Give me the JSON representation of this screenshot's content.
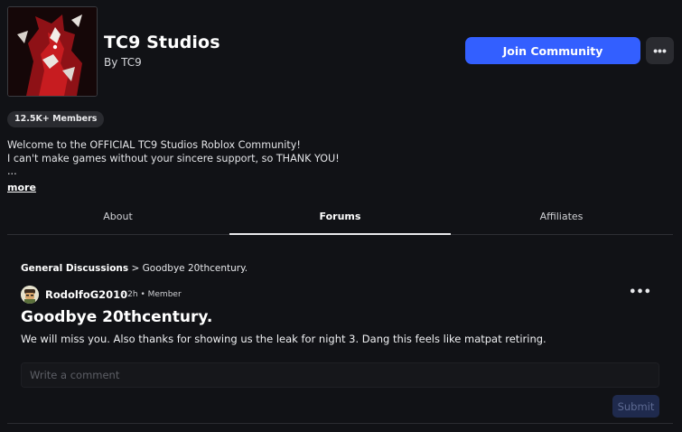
{
  "group": {
    "name": "TC9 Studios",
    "owner_line": "By TC9",
    "members_badge": "12.5K+ Members",
    "join_label": "Join Community",
    "more_menu_icon": "ellipsis-icon"
  },
  "description": {
    "lines": [
      "Welcome to the OFFICIAL TC9 Studios Roblox Community!",
      "I can't make games without your sincere support, so THANK YOU!",
      "..."
    ],
    "more_label": "more"
  },
  "tabs": [
    {
      "label": "About",
      "active": false
    },
    {
      "label": "Forums",
      "active": true
    },
    {
      "label": "Affiliates",
      "active": false
    }
  ],
  "post": {
    "breadcrumb_category": "General Discussions",
    "breadcrumb_separator": ">",
    "breadcrumb_title": "Goodbye 20thcentury.",
    "author": "RodolfoG2010",
    "meta": "• 2h • Member",
    "title": "Goodbye 20thcentury.",
    "body": "We will miss you. Also thanks for showing us the leak for night 3. Dang this feels like matpat retiring.",
    "menu_icon": "ellipsis-icon"
  },
  "comment": {
    "placeholder": "Write a comment",
    "submit_label": "Submit"
  },
  "colors": {
    "background": "#111216",
    "accent": "#335fff",
    "surface": "#2a2b30"
  }
}
